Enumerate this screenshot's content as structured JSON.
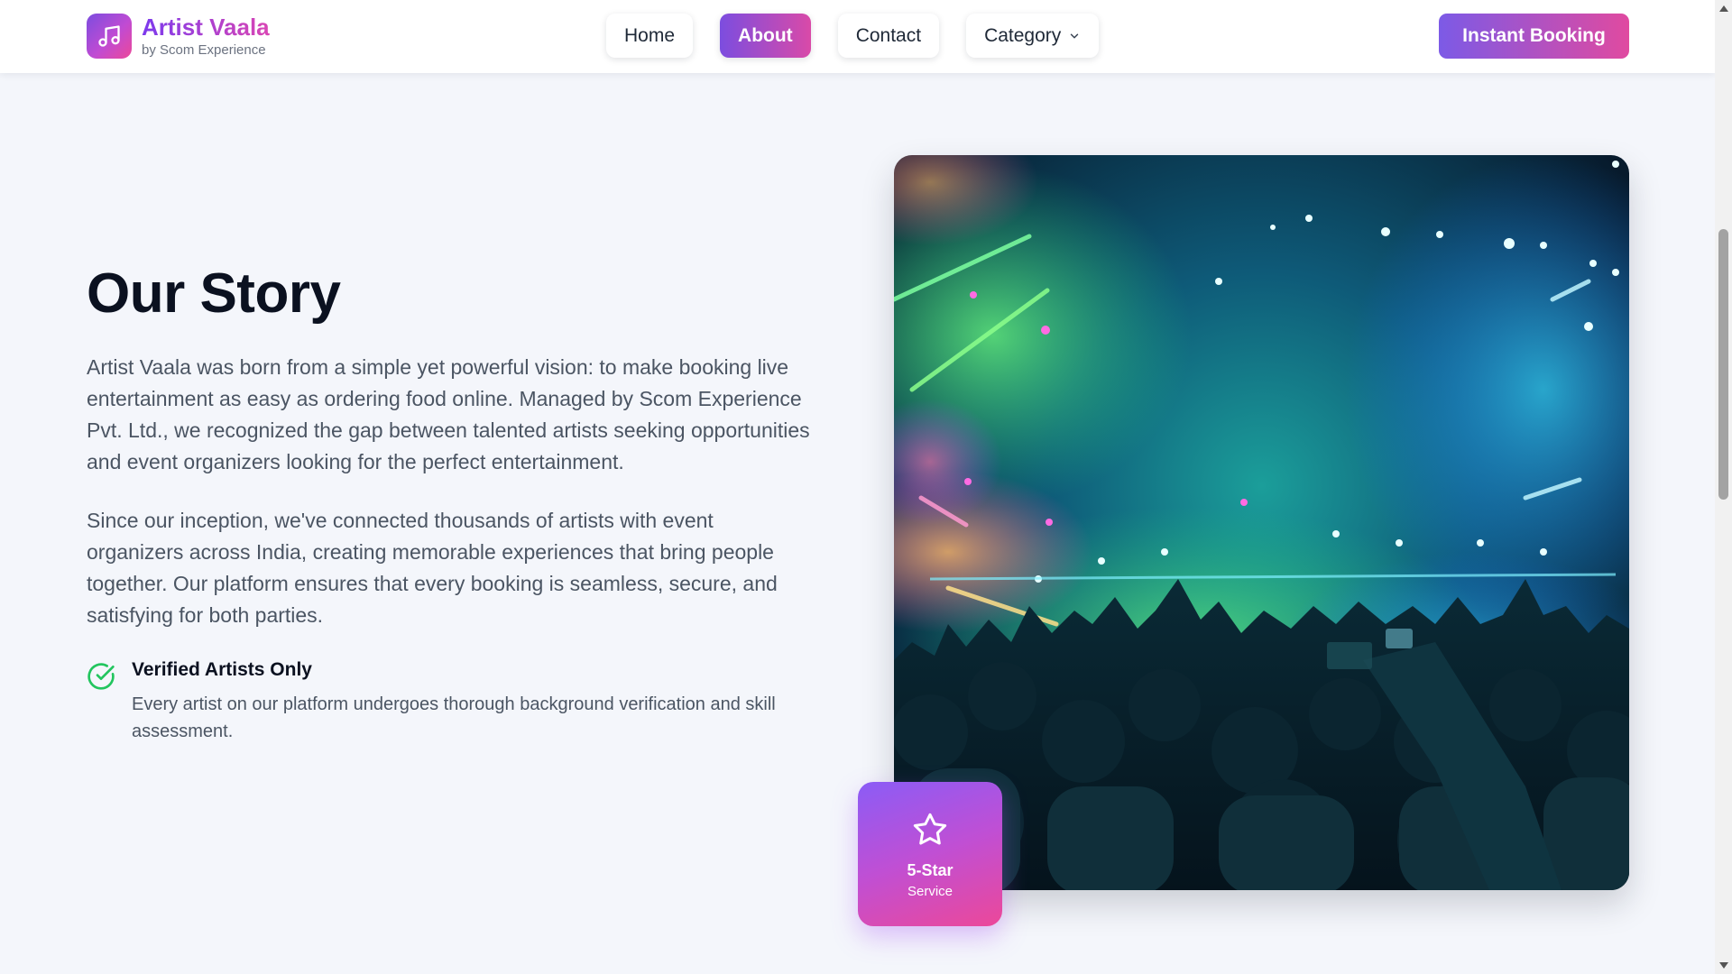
{
  "brand": {
    "name": "Artist Vaala",
    "subtitle": "by Scom Experience",
    "logo_icon": "music-note-icon"
  },
  "nav": {
    "items": [
      {
        "label": "Home",
        "active": false
      },
      {
        "label": "About",
        "active": true
      },
      {
        "label": "Contact",
        "active": false
      },
      {
        "label": "Category",
        "active": false,
        "dropdown_icon": "chevron-down-icon"
      }
    ],
    "cta_label": "Instant Booking"
  },
  "story": {
    "title": "Our Story",
    "paragraphs": [
      "Artist Vaala was born from a simple yet powerful vision: to make booking live entertainment as easy as ordering food online. Managed by Scom Experience Pvt. Ltd., we recognized the gap between talented artists seeking opportunities and event organizers looking for the perfect entertainment.",
      "Since our inception, we've connected thousands of artists with event organizers across India, creating memorable experiences that bring people together. Our platform ensures that every booking is seamless, secure, and satisfying for both parties."
    ],
    "feature": {
      "icon": "check-circle-icon",
      "title": "Verified Artists Only",
      "description": "Every artist on our platform undergoes thorough background verification and skill assessment."
    }
  },
  "image": {
    "subject": "concert-crowd-photo"
  },
  "badge": {
    "icon": "star-icon",
    "title": "5-Star",
    "subtitle": "Service"
  },
  "colors": {
    "accent_start": "#7c4ddf",
    "accent_end": "#e04aa0",
    "check_green": "#22c55e",
    "page_bg": "#f4f6fb"
  }
}
